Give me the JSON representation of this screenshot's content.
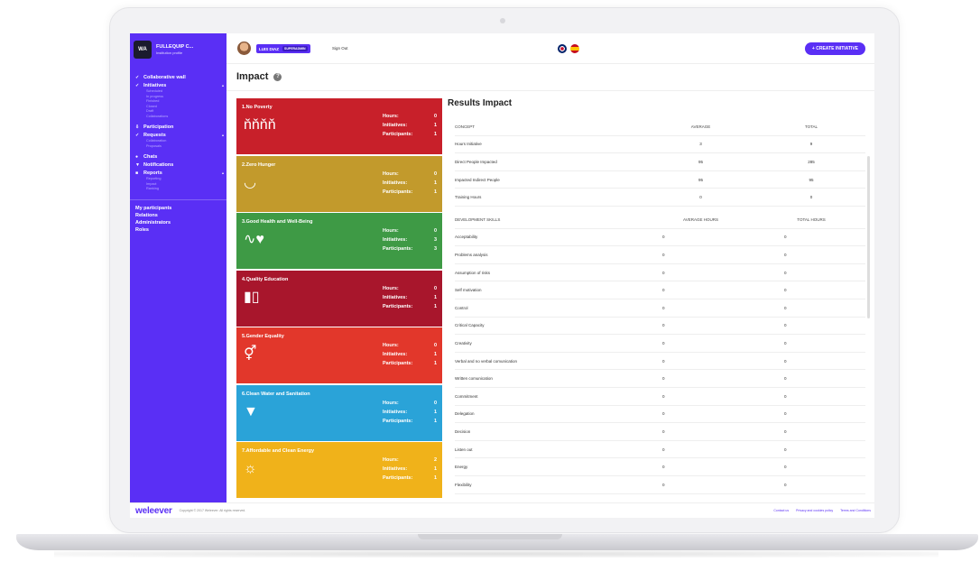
{
  "brand": {
    "badge": "WA",
    "name": "FULLEQUIP C...",
    "subtitle": "Institution profile"
  },
  "sidebar": {
    "groups": [
      {
        "label": "Collaborative wall",
        "icon": "✓",
        "expandable": false,
        "subitems": []
      },
      {
        "label": "Initiatives",
        "icon": "✓",
        "expandable": true,
        "subitems": [
          "Scheduled",
          "In progress",
          "Finished",
          "Closed",
          "Draft",
          "Collaborations"
        ]
      },
      {
        "label": "Participation",
        "icon": "⇩",
        "expandable": false,
        "subitems": []
      },
      {
        "label": "Requests",
        "icon": "✓",
        "expandable": true,
        "subitems": [
          "Collaboration",
          "Proposals"
        ]
      },
      {
        "label": "Chats",
        "icon": "●",
        "expandable": false,
        "subitems": []
      },
      {
        "label": "Notifications",
        "icon": "▼",
        "expandable": false,
        "subitems": []
      },
      {
        "label": "Reports",
        "icon": "■",
        "expandable": true,
        "subitems": [
          "Reporting",
          "Impact",
          "Ranking"
        ]
      }
    ],
    "bottom_items": [
      "My participants",
      "Relations",
      "Administrators",
      "Roles"
    ]
  },
  "topbar": {
    "user_name": "LUIS DIAZ",
    "user_role": "SUPERADMIN",
    "sign_out": "Sign Out",
    "create_button": "+ CREATE INITIATIVE"
  },
  "page": {
    "title": "Impact",
    "help_icon": "?"
  },
  "sdg_cards": [
    {
      "title": "1.No Poverty",
      "color": "#c8202a",
      "icon": "ňňňň",
      "hours": "0",
      "initiatives": "1",
      "participants": "1"
    },
    {
      "title": "2.Zero Hunger",
      "color": "#c29a2c",
      "icon": "◡",
      "hours": "0",
      "initiatives": "1",
      "participants": "1"
    },
    {
      "title": "3.Good Health and Well-Being",
      "color": "#3e9a45",
      "icon": "∿♥",
      "hours": "0",
      "initiatives": "3",
      "participants": "3"
    },
    {
      "title": "4.Quality Education",
      "color": "#a8162c",
      "icon": "▮▯",
      "hours": "0",
      "initiatives": "1",
      "participants": "1"
    },
    {
      "title": "5.Gender Equality",
      "color": "#e2372b",
      "icon": "⚥",
      "hours": "0",
      "initiatives": "1",
      "participants": "1"
    },
    {
      "title": "6.Clean Water and Sanitation",
      "color": "#2aa3d8",
      "icon": "▼",
      "hours": "0",
      "initiatives": "1",
      "participants": "1"
    },
    {
      "title": "7.Affordable and Clean Energy",
      "color": "#f0b21a",
      "icon": "☼",
      "hours": "2",
      "initiatives": "1",
      "participants": "1"
    }
  ],
  "stat_labels": {
    "hours": "Hours:",
    "initiatives": "Initiatives:",
    "participants": "Participants:"
  },
  "results": {
    "title": "Results Impact",
    "concept_headers": [
      "CONCEPT",
      "AVERAGE",
      "TOTAL"
    ],
    "concept_rows": [
      [
        "Hours Initiative",
        "3",
        "9"
      ],
      [
        "Direct People Impacted",
        "95",
        "285"
      ],
      [
        "Impacted Indirect People",
        "95",
        "95"
      ],
      [
        "Training Hours",
        "0",
        "0"
      ]
    ],
    "skills_headers": [
      "DEVELOPMENT SKILLS",
      "AVERAGE HOURS",
      "TOTAL HOURS"
    ],
    "skills_rows": [
      [
        "Acceptability",
        "0",
        "0"
      ],
      [
        "Problems analysis",
        "0",
        "0"
      ],
      [
        "Assumption of risks",
        "0",
        "0"
      ],
      [
        "Self motivation",
        "0",
        "0"
      ],
      [
        "Control",
        "0",
        "0"
      ],
      [
        "Critical Capacity",
        "0",
        "0"
      ],
      [
        "Creativity",
        "0",
        "0"
      ],
      [
        "Verbal and no verbal comunication",
        "0",
        "0"
      ],
      [
        "Written comunication",
        "0",
        "0"
      ],
      [
        "Commitment",
        "0",
        "0"
      ],
      [
        "Delegation",
        "0",
        "0"
      ],
      [
        "Decision",
        "0",
        "0"
      ],
      [
        "Listen out",
        "0",
        "0"
      ],
      [
        "Energy",
        "0",
        "0"
      ],
      [
        "Flexibility",
        "0",
        "0"
      ]
    ]
  },
  "footer": {
    "logo": "weleever",
    "copyright": "Copyright © 2017 Weleever. All rights reserved.",
    "links": [
      "Contact us",
      "Privacy and cookies policy",
      "Terms and Conditions"
    ]
  }
}
